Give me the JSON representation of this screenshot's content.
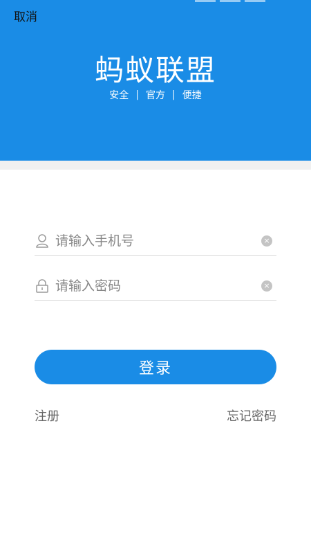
{
  "header": {
    "cancel_label": "取消",
    "app_title": "蚂蚁联盟",
    "taglines": [
      "安全",
      "官方",
      "便捷"
    ],
    "separator": "|"
  },
  "form": {
    "phone_placeholder": "请输入手机号",
    "phone_value": "",
    "password_placeholder": "请输入密码",
    "password_value": "",
    "clear_glyph": "×"
  },
  "actions": {
    "login_label": "登录",
    "register_label": "注册",
    "forgot_label": "忘记密码"
  },
  "colors": {
    "brand_blue": "#1a8ce6",
    "link_gray": "#666666"
  },
  "icons": {
    "phone_field": "user-icon",
    "password_field": "lock-icon",
    "clear": "clear-icon"
  }
}
